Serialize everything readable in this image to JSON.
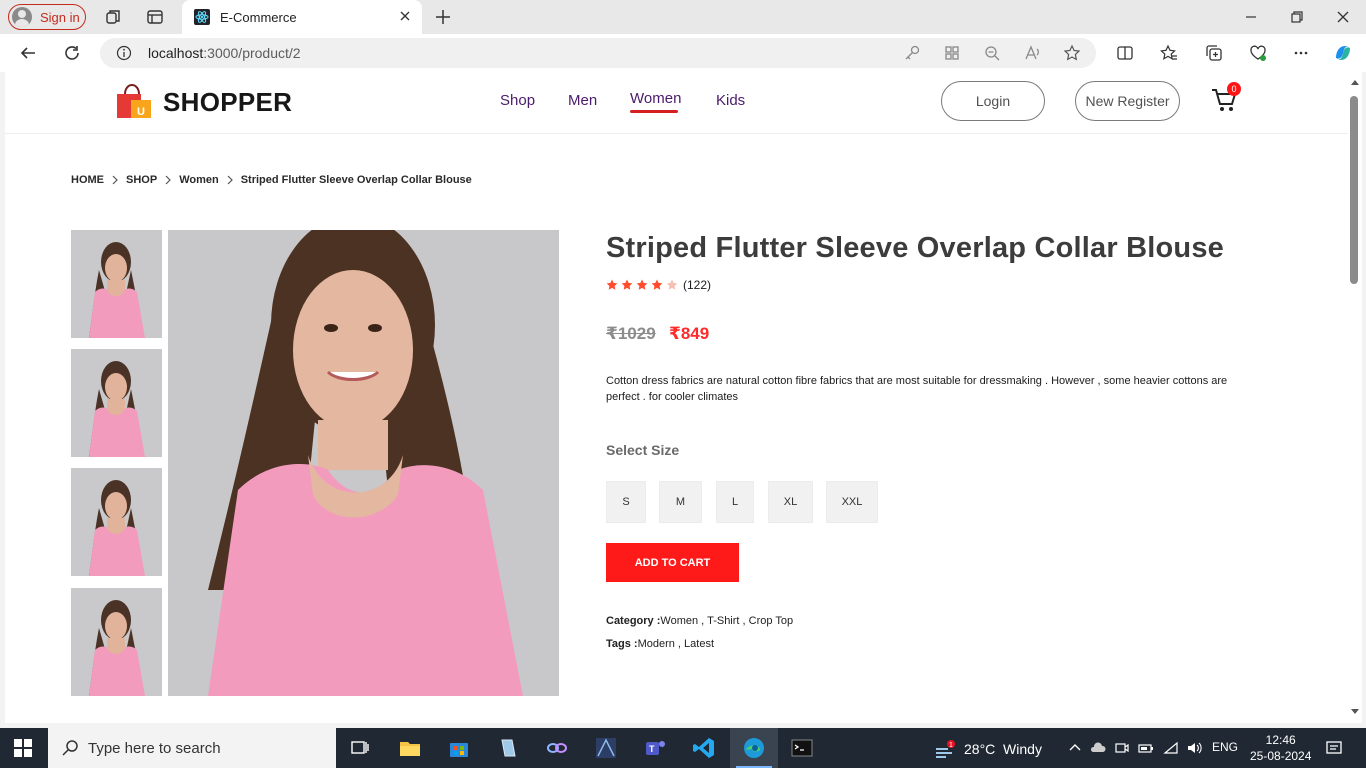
{
  "browser": {
    "signin_label": "Sign in",
    "tab_title": "E-Commerce",
    "url_host": "localhost",
    "url_rest": ":3000/product/2"
  },
  "header": {
    "brand": "SHOPPER",
    "menu": [
      "Shop",
      "Men",
      "Women",
      "Kids"
    ],
    "active_menu": "Women",
    "login_label": "Login",
    "register_label": "New Register",
    "cart_count": "0"
  },
  "breadcrumb": [
    "HOME",
    "SHOP",
    "Women",
    "Striped Flutter Sleeve Overlap Collar Blouse"
  ],
  "product": {
    "title": "Striped Flutter Sleeve Overlap Collar Blouse",
    "rating": 4,
    "rating_max": 5,
    "review_count": "(122)",
    "old_price": "₹1029",
    "new_price": "₹849",
    "description": "Cotton dress fabrics are natural cotton fibre fabrics that are most suitable for dressmaking . However , some heavier cottons are perfect . for cooler climates",
    "size_label": "Select Size",
    "sizes": [
      "S",
      "M",
      "L",
      "XL",
      "XXL"
    ],
    "add_to_cart": "ADD TO CART",
    "category_label": "Category :",
    "category_value": "Women , T-Shirt , Crop Top",
    "tags_label": "Tags :",
    "tags_value": "Modern , Latest"
  },
  "colors": {
    "accent": "#ff1a1a",
    "menu_text": "#4a1b6b",
    "shirt": "#f29bbd"
  },
  "taskbar": {
    "search_placeholder": "Type here to search",
    "weather": "28°C  Windy",
    "weather_badge": "1",
    "lang": "ENG",
    "time": "12:46",
    "date": "25-08-2024"
  }
}
